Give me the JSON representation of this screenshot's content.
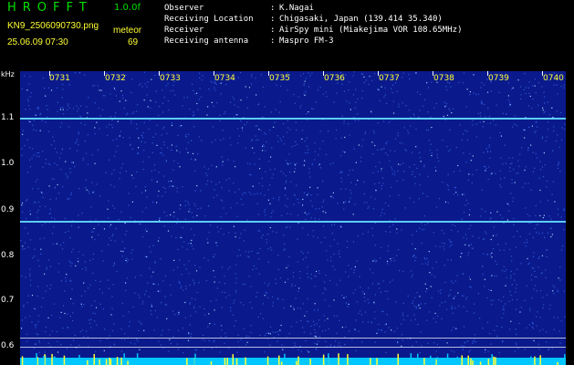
{
  "header": {
    "app_title": "HROFFT",
    "version": "1.0.0f",
    "file_name": "KN9_2506090730.png",
    "mode": "meteor",
    "datetime": "25.06.09 07:30",
    "count": "69",
    "info": [
      {
        "label": "Observer",
        "value": "K.Nagai"
      },
      {
        "label": "Receiving Location",
        "value": "Chigasaki, Japan (139.414 35.340)"
      },
      {
        "label": "Receiver",
        "value": "AirSpy mini (Miakejima VOR 108.65MHz)"
      },
      {
        "label": "Receiving antenna",
        "value": "Maspro FM-3"
      }
    ]
  },
  "spectrogram": {
    "y_unit": "kHz",
    "y_ticks": [
      "1.1",
      "1.0",
      "0.9",
      "0.8",
      "0.7",
      "0.6"
    ],
    "x_ticks": [
      "0731",
      "0732",
      "0733",
      "0734",
      "0735",
      "0736",
      "0737",
      "0738",
      "0739",
      "0740"
    ],
    "colors": {
      "background": "#000000",
      "noise_base": "#0a1a8c",
      "noise_mid": "#2f55d8",
      "noise_hi": "#9fd0ff",
      "tone": "#66e0ff",
      "bottom_bar": "#00c8ff",
      "bottom_spike": "#ffff33"
    }
  }
}
